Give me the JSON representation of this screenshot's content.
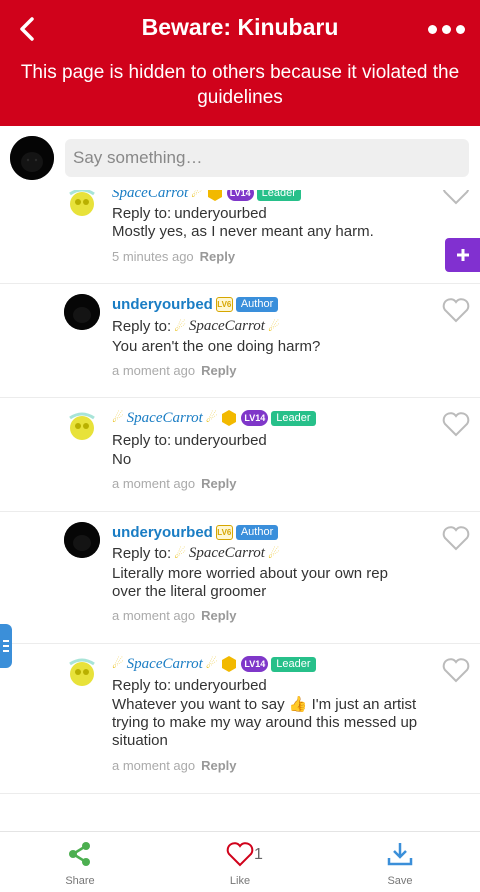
{
  "header": {
    "title": "Beware: Kinubaru",
    "hidden_notice": "This page is hidden to others because it violated the guidelines"
  },
  "comment_bar": {
    "placeholder": "Say something…"
  },
  "comments": [
    {
      "author": "SpaceCarrot",
      "level": "LV14",
      "role": "Leader",
      "reply_label": "Reply to:",
      "reply_to": "underyourbed",
      "text": "Mostly yes, as I never meant any harm.",
      "time": "5 minutes ago",
      "reply": "Reply"
    },
    {
      "author": "underyourbed",
      "level": "LV6",
      "role": "Author",
      "reply_label": "Reply to:",
      "reply_to": "SpaceCarrot",
      "text": "You aren't the one doing harm?",
      "time": "a moment ago",
      "reply": "Reply"
    },
    {
      "author": "SpaceCarrot",
      "level": "LV14",
      "role": "Leader",
      "reply_label": "Reply to:",
      "reply_to": "underyourbed",
      "text": "No",
      "time": "a moment ago",
      "reply": "Reply"
    },
    {
      "author": "underyourbed",
      "level": "LV6",
      "role": "Author",
      "reply_label": "Reply to:",
      "reply_to": "SpaceCarrot",
      "text_lines": [
        "Literally more worried about your own rep",
        "over the literal groomer"
      ],
      "time": "a moment ago",
      "reply": "Reply"
    },
    {
      "author": "SpaceCarrot",
      "level": "LV14",
      "role": "Leader",
      "reply_label": "Reply to:",
      "reply_to": "underyourbed",
      "text_lines": [
        "Whatever you want to say 👍 I'm just an artist",
        "trying to make my way around this messed up",
        "situation"
      ],
      "time": "a moment ago",
      "reply": "Reply"
    }
  ],
  "bottom_bar": {
    "share": "Share",
    "like": "Like",
    "like_count": "1",
    "save": "Save"
  },
  "colors": {
    "header_red": "#d0021b",
    "name_blue": "#1a7dc4",
    "author_tag": "#3a8fdb",
    "leader_tag": "#27c08a",
    "share_green": "#4caf50",
    "save_blue": "#3b8fd9"
  },
  "icons": {
    "back": "back-arrow-icon",
    "more": "more-dots-icon",
    "heart": "heart-icon",
    "share": "share-icon",
    "save": "download-icon",
    "plus": "plus-icon",
    "menu": "menu-icon"
  }
}
